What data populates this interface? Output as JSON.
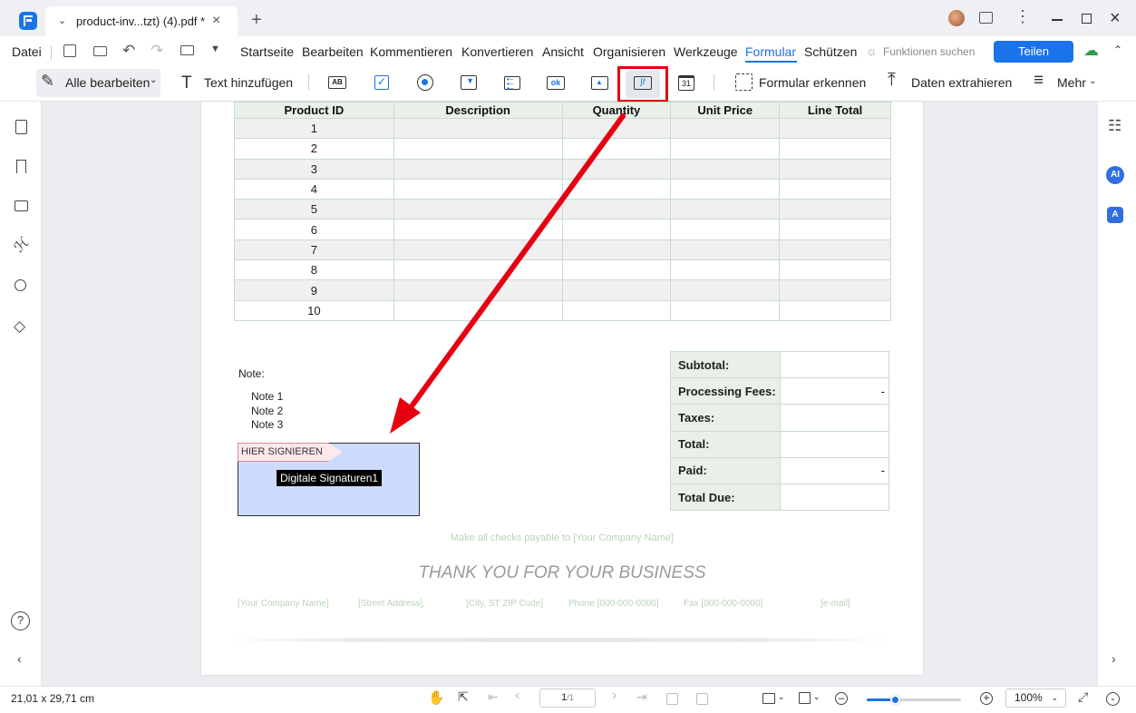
{
  "titlebar": {
    "tab_title": "product-inv...tzt) (4).pdf *",
    "new_tab": "+"
  },
  "menu": {
    "datei": "Datei",
    "items": [
      "Startseite",
      "Bearbeiten",
      "Kommentieren",
      "Konvertieren",
      "Ansicht",
      "Organisieren",
      "Werkzeuge",
      "Formular",
      "Schützen"
    ],
    "active": "Formular",
    "search_placeholder": "Funktionen suchen",
    "share": "Teilen"
  },
  "toolbar": {
    "edit_all": "Alle bearbeiten",
    "add_text": "Text hinzufügen",
    "field_icons": [
      "text-field-icon",
      "checkbox-icon",
      "radio-button-icon",
      "combo-box-icon",
      "list-box-icon",
      "button-icon",
      "image-field-icon",
      "signature-field-icon",
      "date-field-icon"
    ],
    "recognize": "Formular erkennen",
    "extract": "Daten extrahieren",
    "more": "Mehr"
  },
  "invoice": {
    "headers": [
      "Product ID",
      "Description",
      "Quantity",
      "Unit Price",
      "Line Total"
    ],
    "rows": [
      "1",
      "2",
      "3",
      "4",
      "5",
      "6",
      "7",
      "8",
      "9",
      "10"
    ],
    "note_label": "Note:",
    "notes": [
      "Note 1",
      "Note 2",
      "Note 3"
    ],
    "signature_tag": "HIER SIGNIEREN",
    "signature_field": "Digitale Signaturen1",
    "totals": [
      {
        "label": "Subtotal:",
        "value": ""
      },
      {
        "label": "Processing  Fees:",
        "value": "-"
      },
      {
        "label": "Taxes:",
        "value": ""
      },
      {
        "label": "Total:",
        "value": ""
      },
      {
        "label": "Paid:",
        "value": "-"
      },
      {
        "label": "Total Due:",
        "value": ""
      }
    ],
    "checks_payable": "Make all checks payable to [Your Company Name]",
    "thank_you": "THANK YOU FOR YOUR BUSINESS",
    "footer": [
      "[Your Company Name]",
      "[Street Address],",
      "[City, ST ZIP Code]",
      "Phone [000-000-0000]",
      "Fax [000-000-0000]",
      "[e-mail]"
    ]
  },
  "rightbar": {
    "ai": "AI"
  },
  "status": {
    "page_size": "21,01 x 29,71 cm",
    "page_current": "1",
    "page_total": "/1",
    "zoom": "100%",
    "zoom_level": 0.3
  },
  "colors": {
    "accent": "#1a73e8",
    "highlight": "#e60012",
    "signature_fill": "#cddcfd"
  }
}
